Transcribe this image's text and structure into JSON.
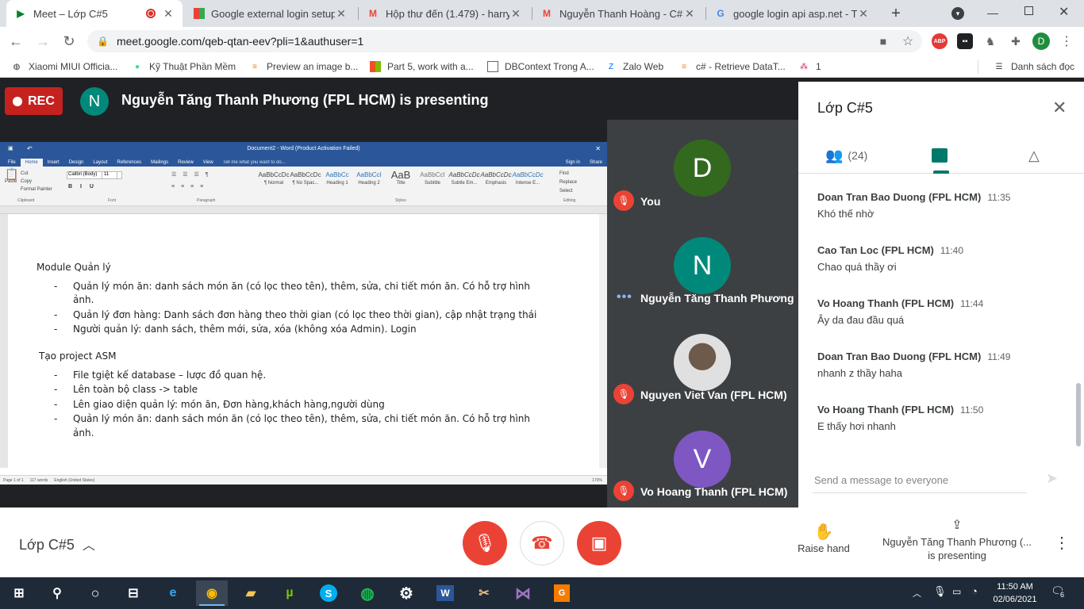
{
  "browser": {
    "tabs": [
      {
        "title": "Meet – Lớp C#5",
        "active": true,
        "recording": true
      },
      {
        "title": "Google external login setup i",
        "active": false
      },
      {
        "title": "Hộp thư đến (1.479) - harrysu",
        "active": false
      },
      {
        "title": "Nguyễn Thanh Hoàng - C# D",
        "active": false
      },
      {
        "title": "google login api asp.net - Tìm",
        "active": false
      }
    ],
    "new_tab": "+",
    "url": "meet.google.com/qeb-qtan-eev?pli=1&authuser=1",
    "profile_initial": "D",
    "abp_label": "ABP",
    "bookmarks": [
      "Xiaomi MIUI Officia...",
      "Kỹ Thuật Phần Mềm",
      "Preview an image b...",
      "Part 5, work with a...",
      "DBContext Trong A...",
      "Zalo Web",
      "c# - Retrieve DataT...",
      "1"
    ],
    "reading_list": "Danh sách đọc"
  },
  "meet": {
    "rec_label": "REC",
    "presenter_initial": "N",
    "presenting_text": "Nguyễn Tăng Thanh Phương (FPL HCM) is presenting",
    "meeting_name": "Lớp C#5",
    "raise_hand": "Raise hand",
    "presenting_footer_1": "Nguyễn Tăng Thanh Phương (...",
    "presenting_footer_2": "is presenting"
  },
  "word": {
    "title": "Document2 - Word (Product Activation Failed)",
    "tabs": [
      "File",
      "Home",
      "Insert",
      "Design",
      "Layout",
      "References",
      "Mailings",
      "Review",
      "View"
    ],
    "tell_me": "Tell me what you want to do...",
    "sign_in": "Sign in",
    "share": "Share",
    "styles": [
      {
        "sample": "AaBbCcDc",
        "name": "¶ Normal"
      },
      {
        "sample": "AaBbCcDc",
        "name": "¶ No Spac..."
      },
      {
        "sample": "AaBbCc",
        "name": "Heading 1"
      },
      {
        "sample": "AaBbCcI",
        "name": "Heading 2"
      },
      {
        "sample": "AaB",
        "name": "Title"
      },
      {
        "sample": "AaBbCcI",
        "name": "Subtitle"
      },
      {
        "sample": "AaBbCcDc",
        "name": "Subtle Em..."
      },
      {
        "sample": "AaBbCcDc",
        "name": "Emphasis"
      },
      {
        "sample": "AaBbCcDc",
        "name": "Intense E..."
      }
    ],
    "font_name": "Calibri (Body)",
    "font_size": "11",
    "groups": {
      "clipboard": "Clipboard",
      "font": "Font",
      "paragraph": "Paragraph",
      "styles": "Styles",
      "editing": "Editing"
    },
    "clipboard": {
      "cut": "Cut",
      "copy": "Copy",
      "paste": "Paste",
      "format_painter": "Format Painter"
    },
    "editing": {
      "find": "Find",
      "replace": "Replace",
      "select": "Select"
    },
    "heading1": "Module Quản lý",
    "list1": [
      "Quản lý món ăn: danh sách món ăn (có lọc theo tên), thêm, sửa, chi tiết món ăn. Có hỗ trợ hình",
      "ảnh.",
      "Quản lý đơn hàng: Danh sách đơn hàng theo thời gian (có lọc theo thời gian), cập nhật trạng thái",
      "Người quản lý: danh sách, thêm mới, sửa, xóa (không xóa Admin). Login"
    ],
    "heading2": "Tạo project ASM",
    "list2": [
      "File tgiệt kế database – lược đồ quan hệ.",
      "Lên toàn bộ class -> table",
      "Lên giao diện quản lý: món ăn, Đơn hàng,khách hàng,người dùng",
      "Quản lý món ăn: danh sách món ăn (có lọc theo tên), thêm, sửa, chi tiết món ăn. Có hỗ trợ hình",
      "ảnh."
    ],
    "status_page": "Page 1 of 1",
    "status_words": "117 words",
    "status_lang": "English (United States)",
    "zoom": "170%"
  },
  "participants": [
    {
      "initial": "D",
      "name": "You",
      "color": "#33691e",
      "muted": true
    },
    {
      "initial": "N",
      "name": "Nguyễn Tăng Thanh Phương ...",
      "color": "#00897b",
      "muted": false
    },
    {
      "initial": "",
      "name": "Nguyen Viet Van (FPL HCM)",
      "color": "#9e9e9e",
      "muted": true
    },
    {
      "initial": "V",
      "name": "Vo Hoang Thanh (FPL HCM)",
      "color": "#7e57c2",
      "muted": true
    }
  ],
  "panel": {
    "title": "Lớp C#5",
    "people_count": "(24)",
    "messages": [
      {
        "sender": "Doan Tran Bao Duong (FPL HCM)",
        "time": "11:35",
        "text": "Khó thế nhờ"
      },
      {
        "sender": "Cao Tan Loc (FPL HCM)",
        "time": "11:40",
        "text": "Chao quá thầy ơi"
      },
      {
        "sender": "Vo Hoang Thanh (FPL HCM)",
        "time": "11:44",
        "text": "Ây da đau đầu quá"
      },
      {
        "sender": "Doan Tran Bao Duong (FPL HCM)",
        "time": "11:49",
        "text": "nhanh z thầy haha"
      },
      {
        "sender": "Vo Hoang Thanh (FPL HCM)",
        "time": "11:50",
        "text": "E thấy hơi nhanh"
      }
    ],
    "input_placeholder": "Send a message to everyone"
  },
  "taskbar": {
    "time": "11:50 AM",
    "date": "02/06/2021",
    "notification_count": "6"
  }
}
